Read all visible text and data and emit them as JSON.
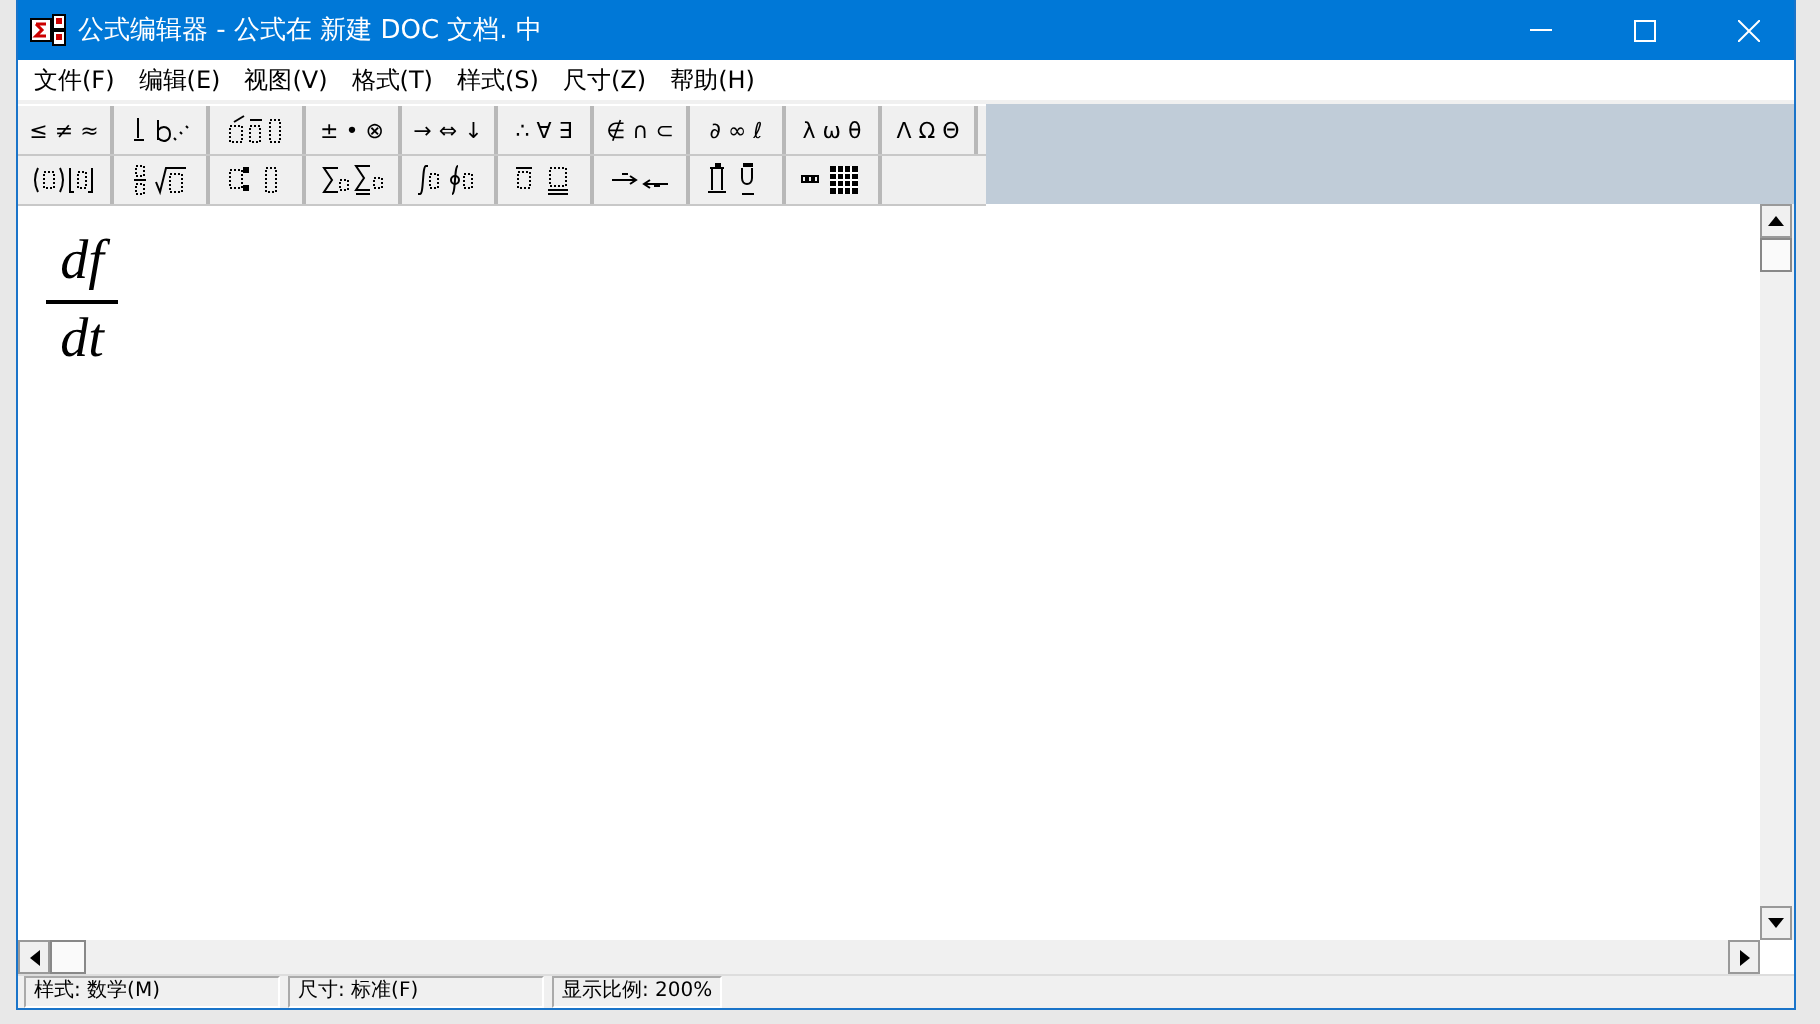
{
  "window": {
    "title": "公式编辑器 - 公式在 新建 DOC 文档. 中"
  },
  "menu": [
    "文件(F)",
    "编辑(E)",
    "视图(V)",
    "格式(T)",
    "样式(S)",
    "尺寸(Z)",
    "帮助(H)"
  ],
  "toolbar_row_1": [
    {
      "kind": "symbols",
      "label": "≤ ≠ ≈"
    },
    {
      "kind": "template"
    },
    {
      "kind": "template"
    },
    {
      "kind": "symbols",
      "label": "± • ⊗"
    },
    {
      "kind": "symbols",
      "label": "→ ⇔ ↓"
    },
    {
      "kind": "symbols",
      "label": "∴ ∀ ∃"
    },
    {
      "kind": "symbols",
      "label": "∉ ∩ ⊂"
    },
    {
      "kind": "symbols",
      "label": "∂ ∞ ℓ"
    },
    {
      "kind": "symbols",
      "label": "λ ω θ"
    },
    {
      "kind": "symbols",
      "label": "Λ Ω Θ"
    }
  ],
  "toolbar_row_2": [
    {
      "kind": "template"
    },
    {
      "kind": "template"
    },
    {
      "kind": "template"
    },
    {
      "kind": "template"
    },
    {
      "kind": "template"
    },
    {
      "kind": "template"
    },
    {
      "kind": "template"
    },
    {
      "kind": "template"
    },
    {
      "kind": "template"
    }
  ],
  "formula": {
    "numerator": "df",
    "denominator": "dt"
  },
  "status_bar": [
    "样式: 数学(M)",
    "尺寸: 标准(F)",
    "显示比例: 200%"
  ]
}
